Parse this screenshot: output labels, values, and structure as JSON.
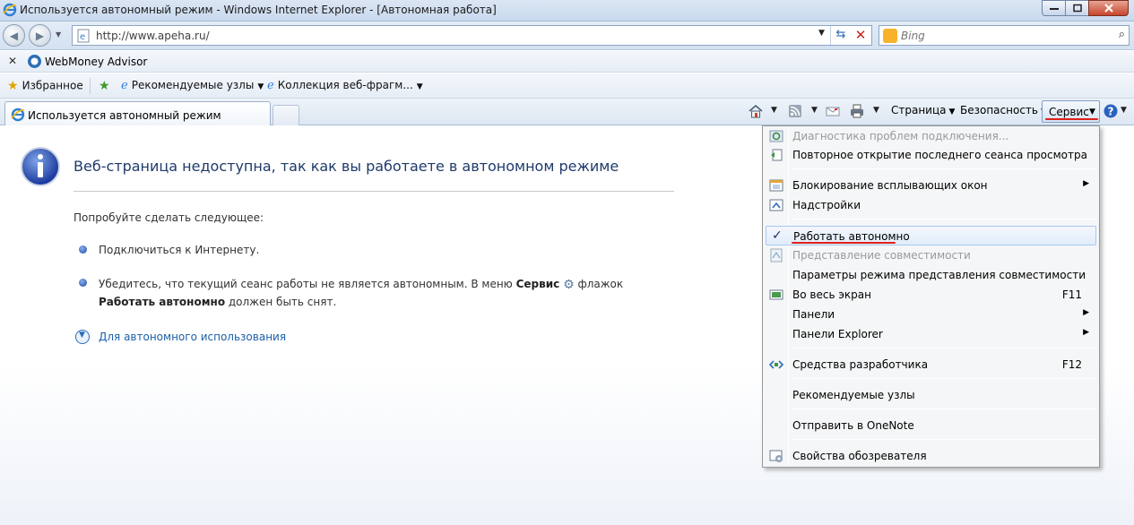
{
  "window": {
    "title": "Используется автономный режим - Windows Internet Explorer - [Автономная работа]"
  },
  "address_bar": {
    "url": "http://www.apeha.ru/",
    "search_placeholder": "Bing"
  },
  "webmoney_toolbar": {
    "label": "WebMoney Advisor"
  },
  "favorites_bar": {
    "favorites_label": "Избранное",
    "items": [
      {
        "label": "Рекомендуемые узлы"
      },
      {
        "label": "Коллекция веб-фрагм..."
      }
    ]
  },
  "tabs": [
    {
      "label": "Используется автономный режим",
      "active": true
    }
  ],
  "command_bar": {
    "page_label": "Страница",
    "safety_label": "Безопасность",
    "tools_label": "Сервис"
  },
  "content": {
    "title": "Веб-страница недоступна, так как вы работаете в автономном режиме",
    "try_text": "Попробуйте сделать следующее:",
    "bullet1": "Подключиться к Интернету.",
    "bullet2_part1": "Убедитесь, что текущий сеанс работы не является автономным. В меню ",
    "bullet2_bold1": "Сервис",
    "bullet2_part2": " флажок",
    "bullet2_bold2": "Работать автономно",
    "bullet2_part3": " должен быть снят.",
    "more_info": "Для автономного использования"
  },
  "tools_menu": {
    "items": [
      {
        "label": "Диагностика проблем подключения...",
        "disabled": true,
        "icon": "diagnose-icon"
      },
      {
        "label": "Повторное открытие последнего сеанса просмотра",
        "icon": "reopen-icon"
      },
      {
        "label": "Блокирование всплывающих окон",
        "submenu": true,
        "icon": "popup-blocker-icon"
      },
      {
        "label": "Надстройки",
        "icon": "addons-icon"
      },
      {
        "label": "Работать автономно",
        "checked": true,
        "highlighted": true
      },
      {
        "label": "Представление совместимости",
        "disabled": true,
        "icon": "compat-view-icon"
      },
      {
        "label": "Параметры режима представления совместимости"
      },
      {
        "label": "Во весь экран",
        "shortcut": "F11",
        "icon": "fullscreen-icon"
      },
      {
        "label": "Панели",
        "submenu": true
      },
      {
        "label": "Панели Explorer",
        "submenu": true
      },
      {
        "label": "Средства разработчика",
        "shortcut": "F12",
        "icon": "dev-tools-icon"
      },
      {
        "label": "Рекомендуемые узлы"
      },
      {
        "label": "Отправить в OneNote"
      },
      {
        "label": "Свойства обозревателя",
        "icon": "internet-options-icon"
      }
    ]
  },
  "colors": {
    "accent_red": "#e0201a",
    "title_blue": "#1f3a6b",
    "link_blue": "#1c5fa8"
  }
}
